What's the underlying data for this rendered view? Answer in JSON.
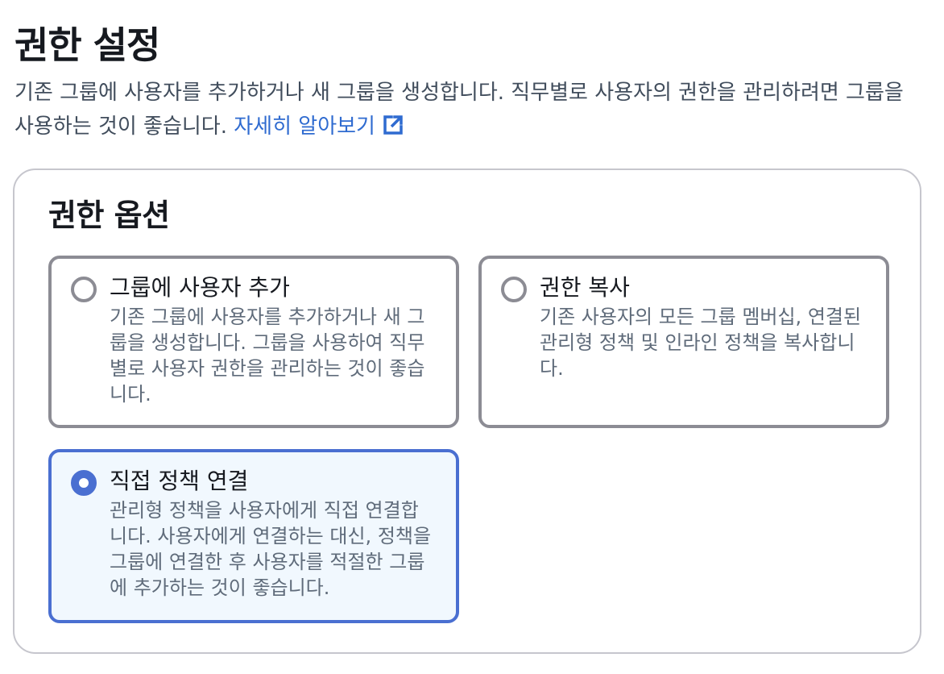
{
  "header": {
    "title": "권한 설정",
    "description": "기존 그룹에 사용자를 추가하거나 새 그룹을 생성합니다. 직무별로 사용자의 권한을 관리하려면 그룹을 사용하는 것이 좋습니다.",
    "learn_more_label": "자세히 알아보기",
    "learn_more_icon": "external-link-icon"
  },
  "options_panel": {
    "title": "권한 옵션",
    "selected_index": 2,
    "options": [
      {
        "label": "그룹에 사용자 추가",
        "description": "기존 그룹에 사용자를 추가하거나 새 그룹을 생성합니다. 그룹을 사용하여 직무별로 사용자 권한을 관리하는 것이 좋습니다."
      },
      {
        "label": "권한 복사",
        "description": "기존 사용자의 모든 그룹 멤버십, 연결된 관리형 정책 및 인라인 정책을 복사합니다."
      },
      {
        "label": "직접 정책 연결",
        "description": "관리형 정책을 사용자에게 직접 연결합니다. 사용자에게 연결하는 대신, 정책을 그룹에 연결한 후 사용자를 적절한 그룹에 추가하는 것이 좋습니다."
      }
    ]
  },
  "colors": {
    "link": "#2f6bd0",
    "selected_border": "#4a6fd1",
    "selected_background": "#f1f8fe",
    "unselected_border": "#8c8c94"
  }
}
